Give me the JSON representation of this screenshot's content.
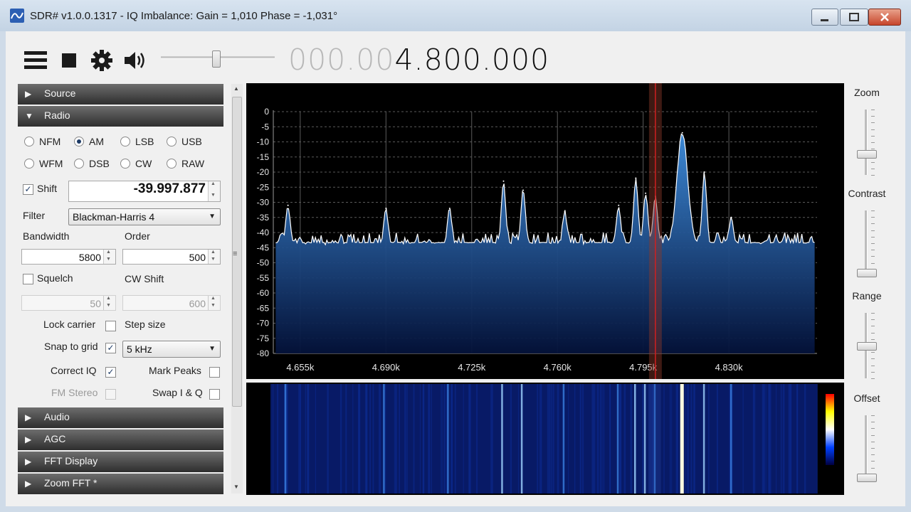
{
  "window": {
    "title": "SDR# v1.0.0.1317 - IQ Imbalance: Gain = 1,010 Phase = -1,031°"
  },
  "toolbar": {
    "menu_icon": "hamburger-menu-icon",
    "stop_icon": "stop-icon",
    "settings_icon": "gear-icon",
    "audio_icon": "speaker-icon",
    "volume_level": 0.5,
    "frequency_dim": "000.00",
    "frequency_bright": "4.800.000"
  },
  "panel": {
    "sections_top": [
      {
        "label": "Source",
        "expanded": false
      },
      {
        "label": "Radio",
        "expanded": true
      }
    ],
    "modes": [
      {
        "label": "NFM",
        "selected": false
      },
      {
        "label": "AM",
        "selected": true
      },
      {
        "label": "LSB",
        "selected": false
      },
      {
        "label": "USB",
        "selected": false
      },
      {
        "label": "WFM",
        "selected": false
      },
      {
        "label": "DSB",
        "selected": false
      },
      {
        "label": "CW",
        "selected": false
      },
      {
        "label": "RAW",
        "selected": false
      }
    ],
    "shift_label": "Shift",
    "shift_checked": true,
    "shift_value": "-39.997.877",
    "filter_label": "Filter",
    "filter_value": "Blackman-Harris 4",
    "bandwidth_label": "Bandwidth",
    "bandwidth_value": "5800",
    "order_label": "Order",
    "order_value": "500",
    "squelch_label": "Squelch",
    "squelch_value": "50",
    "cwshift_label": "CW Shift",
    "cwshift_value": "600",
    "lock_carrier_label": "Lock carrier",
    "step_size_label": "Step size",
    "snap_to_grid_label": "Snap to grid",
    "step_value": "5 kHz",
    "correct_iq_label": "Correct IQ",
    "mark_peaks_label": "Mark Peaks",
    "fm_stereo_label": "FM Stereo",
    "swap_iq_label": "Swap I & Q",
    "sections_bottom": [
      {
        "label": "Audio"
      },
      {
        "label": "AGC"
      },
      {
        "label": "FFT Display"
      },
      {
        "label": "Zoom FFT *"
      }
    ]
  },
  "right_sliders": [
    {
      "label": "Zoom",
      "value": 0.3
    },
    {
      "label": "Contrast",
      "value": 0.0
    },
    {
      "label": "Range",
      "value": 0.5
    },
    {
      "label": "Offset",
      "value": 0.0
    }
  ],
  "chart_data": {
    "type": "line",
    "title": "",
    "xlabel": "",
    "ylabel": "",
    "x_tick_labels": [
      "4.655k",
      "4.690k",
      "4.725k",
      "4.760k",
      "4.795k",
      "4.830k"
    ],
    "x_ticks": [
      4655,
      4690,
      4725,
      4760,
      4795,
      4830
    ],
    "xlim": [
      4644,
      4866
    ],
    "ylim": [
      -80,
      0
    ],
    "y_ticks": [
      0,
      -5,
      -10,
      -15,
      -20,
      -25,
      -30,
      -35,
      -40,
      -45,
      -50,
      -55,
      -60,
      -65,
      -70,
      -75,
      -80
    ],
    "grid": true,
    "tuned_frequency": 4800,
    "peaks": [
      {
        "x": 4650,
        "y": -31
      },
      {
        "x": 4690,
        "y": -32
      },
      {
        "x": 4716,
        "y": -32
      },
      {
        "x": 4738,
        "y": -23
      },
      {
        "x": 4746,
        "y": -26
      },
      {
        "x": 4763,
        "y": -33
      },
      {
        "x": 4785,
        "y": -31
      },
      {
        "x": 4792,
        "y": -22
      },
      {
        "x": 4796,
        "y": -27
      },
      {
        "x": 4800,
        "y": -28
      },
      {
        "x": 4811,
        "y": -7
      },
      {
        "x": 4820,
        "y": -20
      },
      {
        "x": 4831,
        "y": -35
      }
    ],
    "noise_floor": -44,
    "colors": {
      "fill_top": "#3f8fe0",
      "fill_bottom": "#04123a",
      "trace": "#ffffff",
      "tune_line": "#d02020",
      "grid": "#5a5a5a"
    }
  },
  "waterfall": {
    "color_scale": [
      "#ff0000",
      "#ffff00",
      "#ffffff",
      "#0040ff",
      "#000040"
    ]
  }
}
